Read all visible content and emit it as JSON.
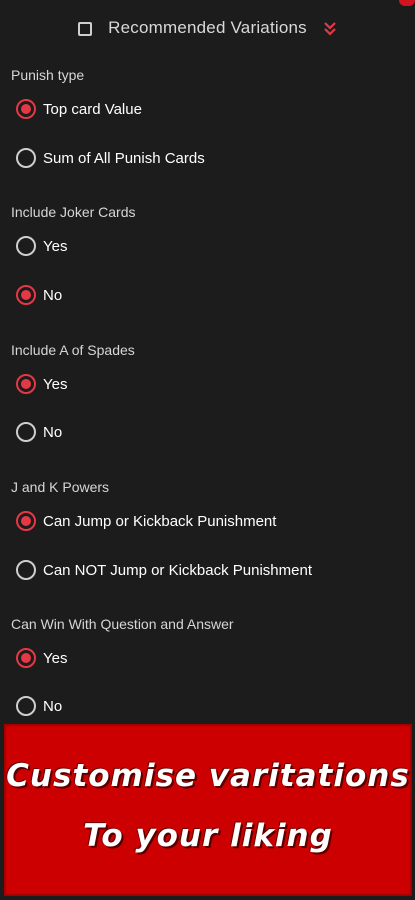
{
  "header": {
    "title": "Recommended Variations",
    "checkbox_checked": false,
    "chevron_icon": "double-chevron-down-icon",
    "accent_color": "#e53845"
  },
  "groups": [
    {
      "title": "Punish type",
      "options": [
        {
          "label": "Top card Value",
          "selected": true
        },
        {
          "label": "Sum of All Punish Cards",
          "selected": false
        }
      ]
    },
    {
      "title": "Include Joker Cards",
      "options": [
        {
          "label": "Yes",
          "selected": false
        },
        {
          "label": "No",
          "selected": true
        }
      ]
    },
    {
      "title": "Include A of Spades",
      "options": [
        {
          "label": "Yes",
          "selected": true
        },
        {
          "label": "No",
          "selected": false
        }
      ]
    },
    {
      "title": "J and K Powers",
      "options": [
        {
          "label": "Can Jump or Kickback Punishment",
          "selected": true
        },
        {
          "label": "Can NOT Jump or Kickback Punishment",
          "selected": false
        }
      ]
    },
    {
      "title": "Can Win With Question and Answer",
      "options": [
        {
          "label": "Yes",
          "selected": true
        },
        {
          "label": "No",
          "selected": false
        }
      ]
    }
  ],
  "banner": {
    "line1": "Customise varitations",
    "line2": "To your liking",
    "background_color": "#cc0000"
  }
}
